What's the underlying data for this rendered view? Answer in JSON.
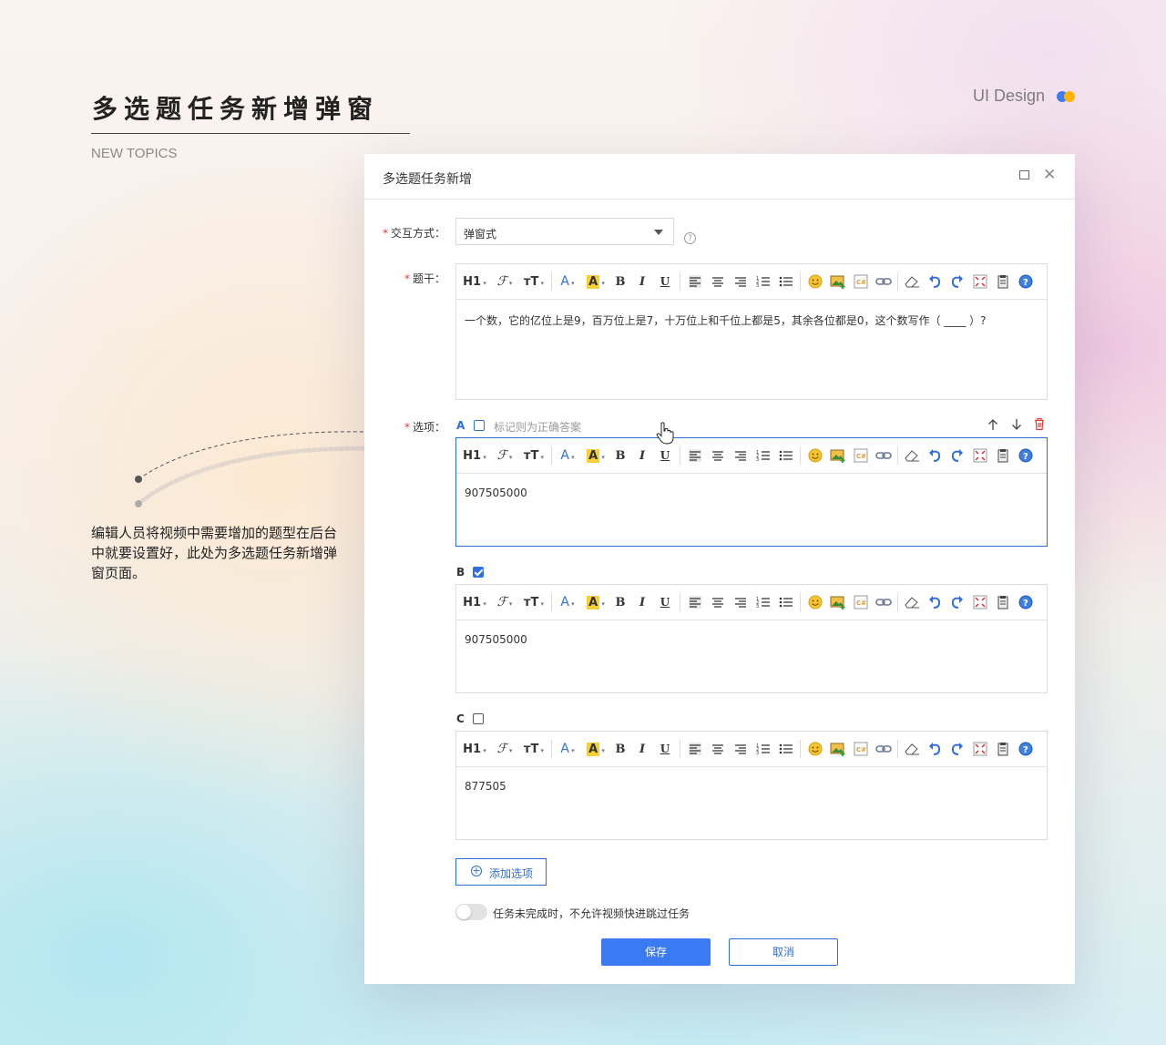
{
  "page": {
    "title": "多选题任务新增弹窗",
    "subtitle": "NEW TOPICS",
    "brand": "UI Design",
    "annotation": "编辑人员将视频中需要增加的题型在后台中就要设置好，此处为多选题任务新增弹窗页面。"
  },
  "colors": {
    "accent": "#3a7af2",
    "required": "#e53935",
    "delete": "#e53935",
    "brand_dot_1": "#3d7cf7",
    "brand_dot_2": "#ffb300"
  },
  "dialog": {
    "title": "多选题任务新增",
    "interaction": {
      "label": "交互方式：",
      "value": "弹窗式"
    },
    "stem": {
      "label": "题干：",
      "content": "一个数，它的亿位上是9，百万位上是7，十万位上和千位上都是5，其余各位都是0，这个数写作（  ____  ）?"
    },
    "options": {
      "label": "选项：",
      "mark_hint": "标记则为正确答案",
      "items": [
        {
          "letter": "A",
          "checked": false,
          "content": "907505000"
        },
        {
          "letter": "B",
          "checked": true,
          "content": "907505000"
        },
        {
          "letter": "C",
          "checked": false,
          "content": "877505"
        }
      ]
    },
    "add_option": "添加选项",
    "toggle_label": "任务未完成时，不允许视频快进跳过任务",
    "toggle_on": false,
    "save": "保存",
    "cancel": "取消"
  },
  "toolbar": {
    "h1": "H1",
    "font": "ℱ",
    "size": "тT",
    "color": "A",
    "bg": "A",
    "bold": "B",
    "italic": "I",
    "underline": "U",
    "icons": [
      "heading-icon",
      "font-family-icon",
      "font-size-icon",
      "font-color-icon",
      "highlight-icon",
      "bold-icon",
      "italic-icon",
      "underline-icon",
      "align-left-icon",
      "align-center-icon",
      "align-right-icon",
      "ordered-list-icon",
      "bullet-list-icon",
      "emoji-icon",
      "image-icon",
      "code-icon",
      "link-icon",
      "eraser-icon",
      "undo-icon",
      "redo-icon",
      "fullscreen-icon",
      "paste-icon",
      "help-icon"
    ]
  }
}
